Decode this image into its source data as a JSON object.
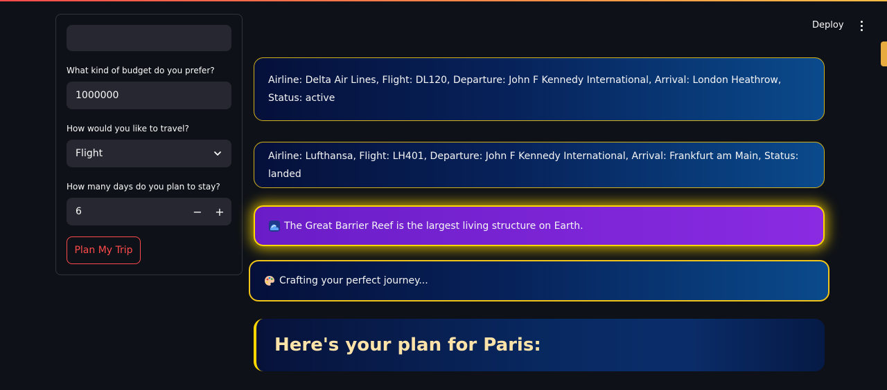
{
  "header": {
    "deploy_label": "Deploy",
    "menu_icon": "more-vertical-icon"
  },
  "form": {
    "budget_label": "What kind of budget do you prefer?",
    "budget_value": "1000000",
    "travel_label": "How would you like to travel?",
    "travel_value": "Flight",
    "days_label": "How many days do you plan to stay?",
    "days_value": "6",
    "minus_label": "−",
    "plus_label": "+",
    "submit_label": "Plan My Trip"
  },
  "flights": [
    {
      "text": "Airline: Delta Air Lines, Flight: DL120, Departure: John F Kennedy International, Arrival: London Heathrow, Status: active"
    },
    {
      "text": "Airline: Lufthansa, Flight: LH401, Departure: John F Kennedy International, Arrival: Frankfurt am Main, Status: landed"
    }
  ],
  "fact": {
    "icon": "wave-icon",
    "text": "The Great Barrier Reef is the largest living structure on Earth."
  },
  "status": {
    "icon": "palette-icon",
    "text": "Crafting your perfect journey..."
  },
  "plan": {
    "title": "Here's your plan for Paris:"
  },
  "colors": {
    "accent_red": "#ff4b4b",
    "gold": "#ffd700",
    "purple": "#8a2be2",
    "background": "#0e1117"
  }
}
